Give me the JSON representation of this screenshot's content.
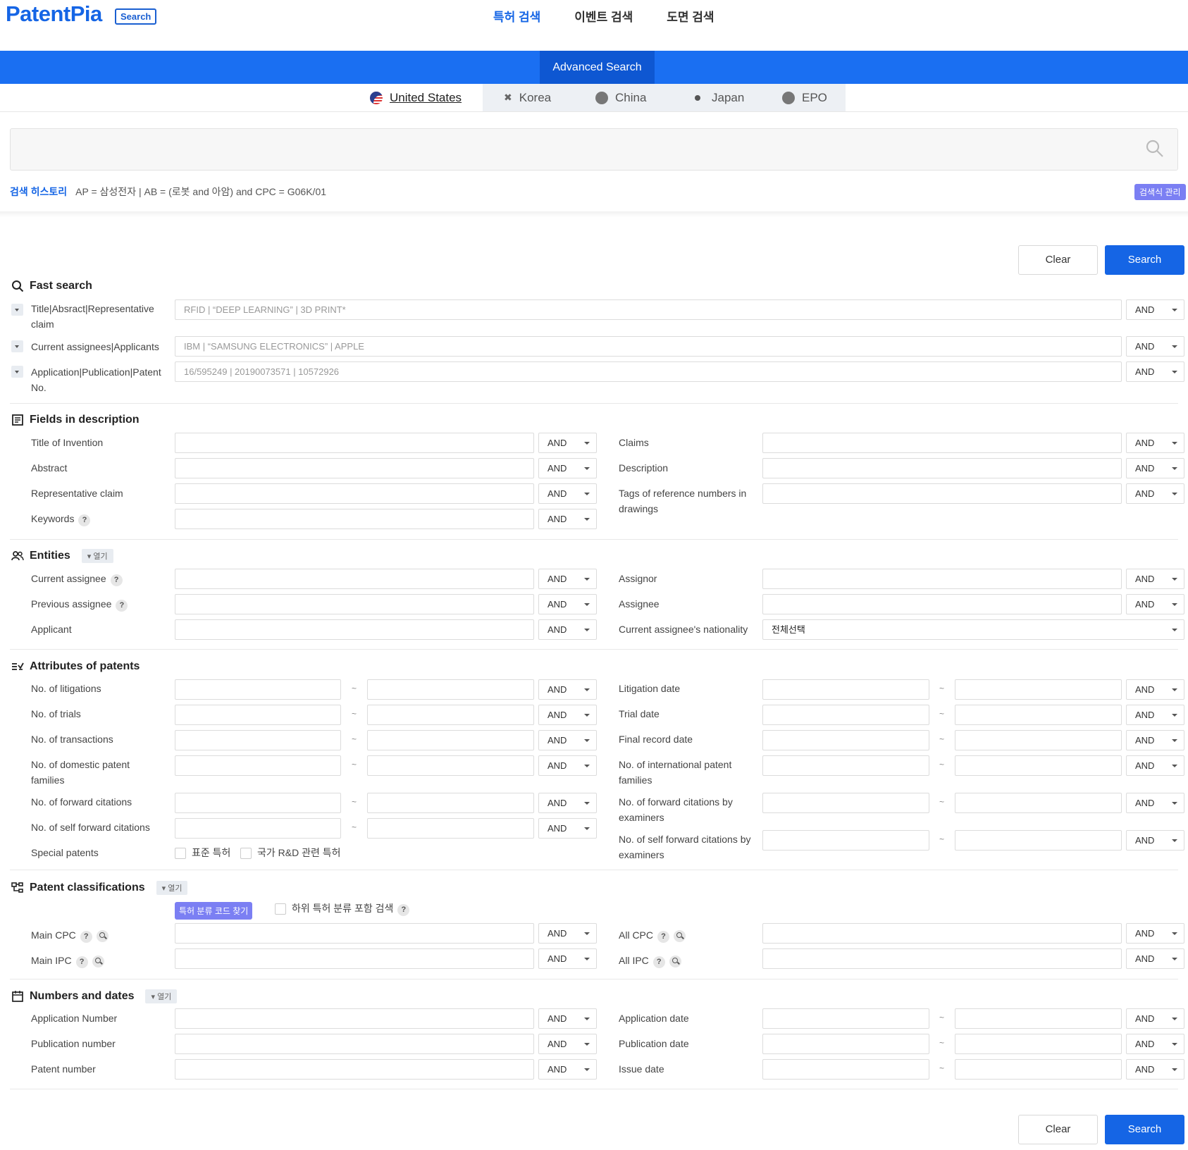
{
  "header": {
    "logo": "PatentPia",
    "logo_badge": "Search",
    "nav": [
      "특허 검색",
      "이벤트 검색",
      "도면 검색"
    ]
  },
  "bluebar": {
    "tab": "Advanced Search"
  },
  "countries": [
    "United States",
    "Korea",
    "China",
    "Japan",
    "EPO"
  ],
  "history": {
    "label": "검색 히스토리",
    "query": "AP = 삼성전자 |  AB = (로봇 and 아암) and CPC = G06K/01",
    "manage": "검색식 관리"
  },
  "buttons": {
    "clear": "Clear",
    "search": "Search"
  },
  "op": "AND",
  "fast": {
    "title": "Fast search",
    "rows": [
      {
        "label": "Title|Absract|Representative claim",
        "placeholder": "RFID | “DEEP LEARNING” | 3D PRINT*"
      },
      {
        "label": "Current assignees|Applicants",
        "placeholder": "IBM | “SAMSUNG ELECTRONICS” | APPLE"
      },
      {
        "label": "Application|Publication|Patent No.",
        "placeholder": "16/595249 | 20190073571 | 10572926"
      }
    ]
  },
  "fields": {
    "title": "Fields in description",
    "left": [
      "Title of Invention",
      "Abstract",
      "Representative claim",
      "Keywords"
    ],
    "right": [
      "Claims",
      "Description",
      "Tags of reference numbers in drawings"
    ]
  },
  "entities": {
    "title": "Entities",
    "open": "열기",
    "left": [
      "Current assignee",
      "Previous assignee",
      "Applicant"
    ],
    "right": [
      "Assignor",
      "Assignee",
      "Current assignee's nationality"
    ],
    "nationality_value": "전체선택"
  },
  "attributes": {
    "title": "Attributes of patents",
    "left": [
      "No. of litigations",
      "No. of trials",
      "No. of transactions",
      "No. of domestic patent families",
      "No. of forward citations",
      "No. of self forward citations"
    ],
    "right": [
      "Litigation date",
      "Trial date",
      "Final record date",
      "No. of international patent families",
      "No. of forward citations by examiners",
      "No. of self forward citations by examiners"
    ],
    "special_label": "Special patents",
    "special_opts": [
      "표준 특허",
      "국가 R&D 관련 특허"
    ],
    "tilde": "~"
  },
  "classifications": {
    "title": "Patent classifications",
    "open": "열기",
    "find_btn": "특허 분류 코드 찾기",
    "include_sub": "하위 특허 분류 포함 검색",
    "left": [
      "Main CPC",
      "Main IPC"
    ],
    "right": [
      "All CPC",
      "All IPC"
    ]
  },
  "numbers": {
    "title": "Numbers and dates",
    "open": "열기",
    "left": [
      "Application Number",
      "Publication number",
      "Patent number"
    ],
    "right": [
      "Application date",
      "Publication date",
      "Issue date"
    ]
  }
}
